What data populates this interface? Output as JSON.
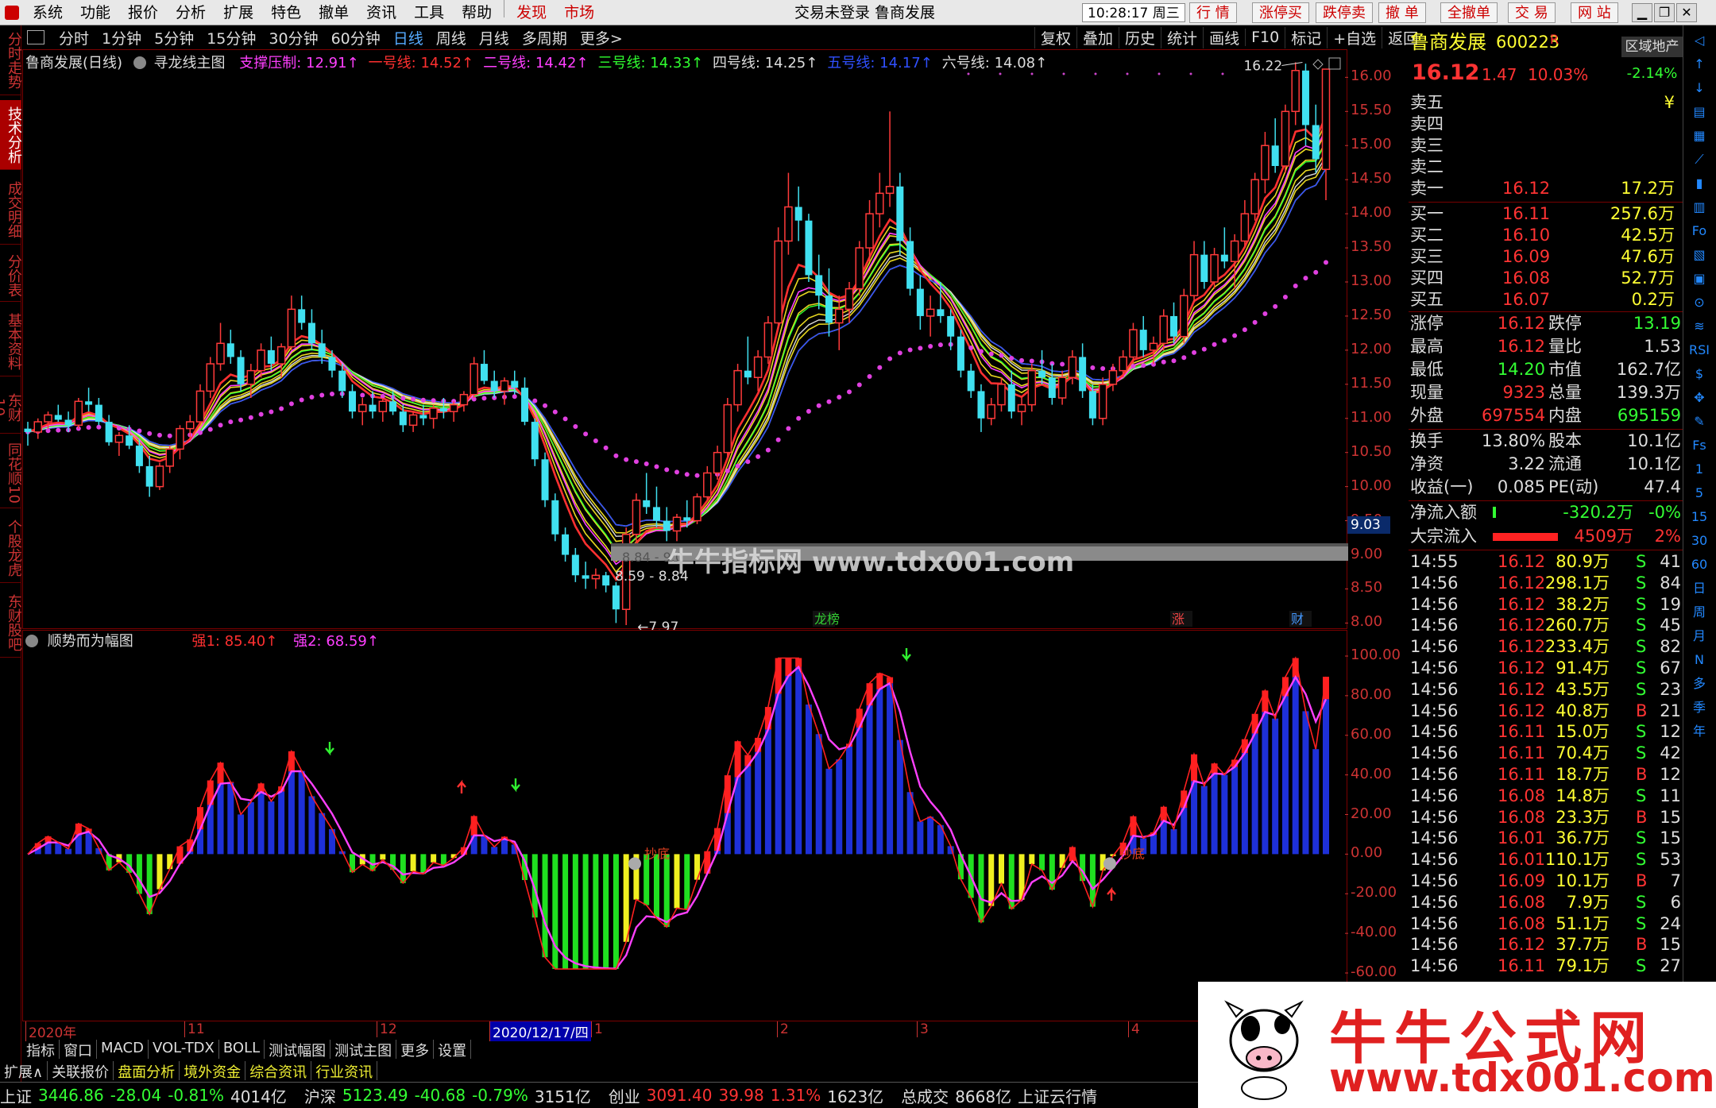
{
  "menu": {
    "items": [
      "系统",
      "功能",
      "报价",
      "分析",
      "扩展",
      "特色",
      "撤单",
      "资讯",
      "工具",
      "帮助"
    ],
    "hl_items": [
      "发现",
      "市场"
    ],
    "title": "交易未登录  鲁商发展",
    "clock": "10:28:17 周三",
    "right_buttons": [
      "行 情",
      "涨停买",
      "跌停卖",
      "撤 单",
      "全撤单",
      "交 易",
      "网 站"
    ]
  },
  "leftbar": [
    "分时走势",
    "技术分析",
    "成交明细",
    "分价表",
    "基本资料",
    "东财10",
    "同花顺10",
    "个股龙虎",
    "东财股吧"
  ],
  "toolbar": {
    "periods": [
      "分时",
      "1分钟",
      "5分钟",
      "15分钟",
      "30分钟",
      "60分钟",
      "日线",
      "周线",
      "月线",
      "多周期",
      "更多>"
    ],
    "active": "日线",
    "right": [
      "复权",
      "叠加",
      "历史",
      "统计",
      "画线",
      "F10",
      "标记",
      "+自选",
      "返回"
    ]
  },
  "main_legend": {
    "stock": "鲁商发展(日线)",
    "indicator": "寻龙线主图",
    "lines": [
      {
        "label": "支撑压制: 12.91",
        "color": "#ff3fff"
      },
      {
        "label": "一号线: 14.52",
        "color": "#ff3030"
      },
      {
        "label": "二号线: 14.42",
        "color": "#ff3fff"
      },
      {
        "label": "三号线: 14.33",
        "color": "#30ff30"
      },
      {
        "label": "四号线: 14.25",
        "color": "#dddddd"
      },
      {
        "label": "五号线: 14.17",
        "color": "#3050ff"
      },
      {
        "label": "六号线: 14.08",
        "color": "#dddddd"
      }
    ]
  },
  "main_axis": [
    "16.00",
    "15.50",
    "15.00",
    "14.50",
    "14.00",
    "13.50",
    "13.00",
    "12.50",
    "12.00",
    "11.50",
    "11.00",
    "10.50",
    "10.00",
    "9.50",
    "9.00",
    "8.50",
    "8.00"
  ],
  "main_annotations": {
    "high": "16.22",
    "low": "7.97",
    "range1": "8.84 - 9.0",
    "range2": "8.59 - 8.84",
    "cursor_price": "9.03",
    "badges": [
      "龙榜",
      "涨",
      "财"
    ]
  },
  "sub_legend": {
    "indicator": "顺势而为幅图",
    "q1": "强1: 85.40",
    "q2": "强2: 68.59"
  },
  "sub_axis": [
    "100.00",
    "80.00",
    "60.00",
    "40.00",
    "20.00",
    "0.00",
    "-20.00",
    "-40.00",
    "-60.00"
  ],
  "sub_annotations": [
    "抄底",
    "抄底"
  ],
  "datebar": [
    "2020年",
    "11",
    "12",
    "2020/12/17/四",
    "1",
    "2",
    "3",
    "4"
  ],
  "ind_tabs": [
    "指标",
    "窗口",
    "MACD",
    "VOL-TDX",
    "BOLL",
    "测试幅图",
    "测试主图",
    "更多",
    "设置"
  ],
  "bottom_tabs": [
    "扩展∧",
    "关联报价",
    "盘面分析",
    "境外资金",
    "综合资讯",
    "行业资讯"
  ],
  "status": [
    {
      "t": "上证",
      "c": "#ddd"
    },
    {
      "t": "3446.86",
      "c": "#3f3"
    },
    {
      "t": "-28.04",
      "c": "#3f3"
    },
    {
      "t": "-0.81%",
      "c": "#3f3"
    },
    {
      "t": "4014亿",
      "c": "#ddd"
    },
    {
      "t": "沪深",
      "c": "#ddd"
    },
    {
      "t": "5123.49",
      "c": "#3f3"
    },
    {
      "t": "-40.68",
      "c": "#3f3"
    },
    {
      "t": "-0.79%",
      "c": "#3f3"
    },
    {
      "t": "3151亿",
      "c": "#ddd"
    },
    {
      "t": "创业",
      "c": "#ddd"
    },
    {
      "t": "3091.40",
      "c": "#f33"
    },
    {
      "t": "39.98",
      "c": "#f33"
    },
    {
      "t": "1.31%",
      "c": "#f33"
    },
    {
      "t": "1623亿",
      "c": "#ddd"
    },
    {
      "t": "总成交",
      "c": "#ddd"
    },
    {
      "t": "8668亿",
      "c": "#ddd"
    },
    {
      "t": "上证云行情",
      "c": "#ddd"
    }
  ],
  "quote": {
    "name": "鲁商发展",
    "code": "600223",
    "tag": "R",
    "sector": "区域地产",
    "sector_pct": "-2.14%",
    "price": "16.12",
    "change": "1.47",
    "pct": "10.03%",
    "asks": [
      {
        "l": "卖五",
        "p": "",
        "v": "¥"
      },
      {
        "l": "卖四",
        "p": "",
        "v": ""
      },
      {
        "l": "卖三",
        "p": "",
        "v": ""
      },
      {
        "l": "卖二",
        "p": "",
        "v": ""
      },
      {
        "l": "卖一",
        "p": "16.12",
        "v": "17.2万"
      }
    ],
    "bids": [
      {
        "l": "买一",
        "p": "16.11",
        "v": "257.6万"
      },
      {
        "l": "买二",
        "p": "16.10",
        "v": "42.5万"
      },
      {
        "l": "买三",
        "p": "16.09",
        "v": "47.6万"
      },
      {
        "l": "买四",
        "p": "16.08",
        "v": "52.7万"
      },
      {
        "l": "买五",
        "p": "16.07",
        "v": "0.2万"
      }
    ],
    "stats": [
      [
        "涨停",
        "16.12",
        "跌停",
        "13.19"
      ],
      [
        "最高",
        "16.12",
        "量比",
        "1.53"
      ],
      [
        "最低",
        "14.20",
        "市值",
        "162.7亿"
      ],
      [
        "现量",
        "9323",
        "总量",
        "139.3万"
      ],
      [
        "外盘",
        "697554",
        "内盘",
        "695159"
      ]
    ],
    "stats2": [
      [
        "换手",
        "13.80%",
        "股本",
        "10.1亿"
      ],
      [
        "净资",
        "3.22",
        "流通",
        "10.1亿"
      ],
      [
        "收益(一)",
        "0.085",
        "PE(动)",
        "47.4"
      ]
    ],
    "flow": [
      {
        "l": "净流入额",
        "v": "-320.2万",
        "p": "-0%"
      },
      {
        "l": "大宗流入",
        "v": "4509万",
        "p": "2%"
      }
    ],
    "ticks": [
      [
        "14:55",
        "16.12",
        "80.9万",
        "S",
        "41"
      ],
      [
        "14:56",
        "16.12",
        "298.1万",
        "S",
        "84"
      ],
      [
        "14:56",
        "16.12",
        "38.2万",
        "S",
        "19"
      ],
      [
        "14:56",
        "16.12",
        "260.7万",
        "S",
        "45"
      ],
      [
        "14:56",
        "16.12",
        "233.4万",
        "S",
        "82"
      ],
      [
        "14:56",
        "16.12",
        "91.4万",
        "S",
        "67"
      ],
      [
        "14:56",
        "16.12",
        "43.5万",
        "S",
        "23"
      ],
      [
        "14:56",
        "16.12",
        "40.8万",
        "B",
        "21"
      ],
      [
        "14:56",
        "16.11",
        "15.0万",
        "S",
        "12"
      ],
      [
        "14:56",
        "16.11",
        "70.4万",
        "S",
        "42"
      ],
      [
        "14:56",
        "16.11",
        "18.7万",
        "B",
        "12"
      ],
      [
        "14:56",
        "16.08",
        "14.8万",
        "S",
        "11"
      ],
      [
        "14:56",
        "16.08",
        "23.3万",
        "B",
        "15"
      ],
      [
        "14:56",
        "16.01",
        "36.7万",
        "S",
        "15"
      ],
      [
        "14:56",
        "16.01",
        "110.1万",
        "S",
        "53"
      ],
      [
        "14:56",
        "16.09",
        "10.1万",
        "B",
        "7"
      ],
      [
        "14:56",
        "16.08",
        "7.9万",
        "S",
        "6"
      ],
      [
        "14:56",
        "16.08",
        "51.1万",
        "S",
        "24"
      ],
      [
        "14:56",
        "16.12",
        "37.7万",
        "B",
        "15"
      ],
      [
        "14:56",
        "16.11",
        "79.1万",
        "S",
        "27"
      ]
    ]
  },
  "iconbar": [
    "◁",
    "↑",
    "↓",
    "▤",
    "▦",
    "⟋",
    "▮",
    "▥",
    "Fo",
    "▧",
    "▣",
    "⊙",
    "≋",
    "RSI",
    "$",
    "✥",
    "✎",
    "Fs",
    "1",
    "5",
    "15",
    "30",
    "60",
    "日",
    "周",
    "月",
    "N",
    "多",
    "季",
    "年"
  ],
  "watermark": {
    "line1": "牛牛公式网",
    "line2": "www.tdx001.com",
    "overlay": "牛牛指标网 www.tdx001.com"
  },
  "chart_data": [
    {
      "type": "candlestick",
      "title": "寻龙线主图",
      "ylim": [
        7.9,
        16.4
      ],
      "ohlc": [
        [
          10.85,
          10.95,
          10.6,
          10.8
        ],
        [
          10.8,
          11.0,
          10.7,
          10.95
        ],
        [
          10.95,
          11.1,
          10.85,
          11.05
        ],
        [
          11.05,
          11.2,
          10.95,
          10.98
        ],
        [
          10.98,
          11.1,
          10.8,
          10.9
        ],
        [
          10.9,
          11.3,
          10.85,
          11.25
        ],
        [
          11.25,
          11.45,
          11.1,
          11.2
        ],
        [
          11.2,
          11.3,
          10.9,
          10.95
        ],
        [
          10.95,
          11.05,
          10.6,
          10.65
        ],
        [
          10.65,
          10.8,
          10.45,
          10.75
        ],
        [
          10.75,
          10.9,
          10.55,
          10.6
        ],
        [
          10.6,
          10.7,
          10.2,
          10.3
        ],
        [
          10.3,
          10.45,
          9.85,
          10.0
        ],
        [
          10.0,
          10.35,
          9.95,
          10.3
        ],
        [
          10.3,
          10.6,
          10.2,
          10.55
        ],
        [
          10.55,
          10.9,
          10.4,
          10.85
        ],
        [
          10.85,
          11.05,
          10.7,
          10.95
        ],
        [
          10.95,
          11.5,
          10.9,
          11.4
        ],
        [
          11.4,
          11.9,
          11.3,
          11.8
        ],
        [
          11.8,
          12.4,
          11.7,
          12.1
        ],
        [
          12.1,
          12.3,
          11.8,
          11.9
        ],
        [
          11.9,
          12.0,
          11.4,
          11.5
        ],
        [
          11.5,
          11.8,
          11.3,
          11.7
        ],
        [
          11.7,
          12.1,
          11.6,
          12.0
        ],
        [
          12.0,
          12.2,
          11.7,
          11.8
        ],
        [
          11.8,
          12.1,
          11.6,
          12.05
        ],
        [
          12.05,
          12.8,
          12.0,
          12.6
        ],
        [
          12.6,
          12.8,
          12.3,
          12.4
        ],
        [
          12.4,
          12.6,
          12.0,
          12.1
        ],
        [
          12.1,
          12.3,
          11.8,
          11.9
        ],
        [
          11.9,
          12.0,
          11.6,
          11.7
        ],
        [
          11.7,
          11.8,
          11.3,
          11.4
        ],
        [
          11.4,
          11.5,
          11.0,
          11.1
        ],
        [
          11.1,
          11.3,
          10.9,
          11.2
        ],
        [
          11.2,
          11.4,
          11.0,
          11.1
        ],
        [
          11.1,
          11.3,
          10.95,
          11.25
        ],
        [
          11.25,
          11.4,
          11.05,
          11.1
        ],
        [
          11.1,
          11.2,
          10.8,
          10.9
        ],
        [
          10.9,
          11.1,
          10.8,
          11.05
        ],
        [
          11.05,
          11.2,
          10.9,
          11.0
        ],
        [
          11.0,
          11.2,
          10.85,
          11.15
        ],
        [
          11.15,
          11.3,
          11.0,
          11.1
        ],
        [
          11.1,
          11.25,
          10.95,
          11.2
        ],
        [
          11.2,
          11.4,
          11.1,
          11.35
        ],
        [
          11.35,
          11.9,
          11.3,
          11.8
        ],
        [
          11.8,
          12.0,
          11.5,
          11.55
        ],
        [
          11.55,
          11.7,
          11.3,
          11.4
        ],
        [
          11.4,
          11.6,
          11.2,
          11.55
        ],
        [
          11.55,
          11.7,
          11.35,
          11.45
        ],
        [
          11.45,
          11.6,
          10.9,
          10.95
        ],
        [
          10.95,
          11.0,
          10.3,
          10.4
        ],
        [
          10.4,
          10.5,
          9.7,
          9.8
        ],
        [
          9.8,
          9.9,
          9.2,
          9.3
        ],
        [
          9.3,
          9.4,
          8.9,
          9.0
        ],
        [
          9.0,
          9.1,
          8.6,
          8.7
        ],
        [
          8.7,
          8.9,
          8.5,
          8.65
        ],
        [
          8.65,
          8.8,
          8.5,
          8.7
        ],
        [
          8.7,
          8.75,
          8.45,
          8.55
        ],
        [
          8.55,
          8.6,
          8.0,
          8.2
        ],
        [
          8.2,
          9.4,
          7.97,
          9.3
        ],
        [
          9.3,
          9.9,
          9.2,
          9.8
        ],
        [
          9.8,
          10.2,
          9.6,
          9.7
        ],
        [
          9.7,
          10.0,
          9.4,
          9.5
        ],
        [
          9.5,
          9.7,
          9.2,
          9.35
        ],
        [
          9.35,
          9.6,
          9.2,
          9.55
        ],
        [
          9.55,
          9.8,
          9.4,
          9.5
        ],
        [
          9.5,
          9.9,
          9.45,
          9.85
        ],
        [
          9.85,
          10.3,
          9.8,
          10.2
        ],
        [
          10.2,
          10.6,
          10.1,
          10.5
        ],
        [
          10.5,
          11.3,
          10.4,
          11.2
        ],
        [
          11.2,
          11.8,
          11.1,
          11.7
        ],
        [
          11.7,
          12.2,
          11.5,
          11.6
        ],
        [
          11.6,
          12.0,
          11.4,
          11.9
        ],
        [
          11.9,
          12.5,
          11.8,
          12.4
        ],
        [
          12.4,
          13.8,
          12.3,
          13.6
        ],
        [
          13.6,
          14.6,
          13.4,
          14.1
        ],
        [
          14.1,
          14.4,
          13.6,
          13.9
        ],
        [
          13.9,
          14.0,
          13.0,
          13.1
        ],
        [
          13.1,
          13.4,
          12.6,
          12.8
        ],
        [
          12.8,
          13.2,
          12.2,
          12.4
        ],
        [
          12.4,
          12.8,
          12.0,
          12.6
        ],
        [
          12.6,
          13.0,
          12.4,
          12.9
        ],
        [
          12.9,
          13.6,
          12.8,
          13.5
        ],
        [
          13.5,
          14.2,
          13.3,
          14.0
        ],
        [
          14.0,
          14.6,
          13.8,
          14.3
        ],
        [
          14.3,
          15.5,
          14.1,
          14.4
        ],
        [
          14.4,
          14.6,
          13.4,
          13.6
        ],
        [
          13.6,
          13.8,
          12.8,
          12.9
        ],
        [
          12.9,
          13.1,
          12.3,
          12.5
        ],
        [
          12.5,
          12.8,
          12.2,
          12.6
        ],
        [
          12.6,
          13.0,
          12.4,
          12.5
        ],
        [
          12.5,
          12.6,
          12.0,
          12.2
        ],
        [
          12.2,
          12.3,
          11.6,
          11.7
        ],
        [
          11.7,
          11.8,
          11.3,
          11.4
        ],
        [
          11.4,
          11.5,
          10.8,
          11.0
        ],
        [
          11.0,
          11.3,
          10.9,
          11.2
        ],
        [
          11.2,
          11.6,
          11.1,
          11.5
        ],
        [
          11.5,
          11.7,
          11.0,
          11.1
        ],
        [
          11.1,
          11.3,
          10.9,
          11.2
        ],
        [
          11.2,
          11.8,
          11.1,
          11.7
        ],
        [
          11.7,
          12.0,
          11.5,
          11.6
        ],
        [
          11.6,
          11.8,
          11.2,
          11.3
        ],
        [
          11.3,
          11.7,
          11.2,
          11.6
        ],
        [
          11.6,
          12.0,
          11.5,
          11.9
        ],
        [
          11.9,
          12.1,
          11.3,
          11.4
        ],
        [
          11.4,
          11.5,
          10.9,
          11.0
        ],
        [
          11.0,
          11.6,
          10.9,
          11.5
        ],
        [
          11.5,
          11.8,
          11.4,
          11.7
        ],
        [
          11.7,
          12.0,
          11.6,
          11.9
        ],
        [
          11.9,
          12.4,
          11.8,
          12.3
        ],
        [
          12.3,
          12.5,
          11.9,
          12.0
        ],
        [
          12.0,
          12.2,
          11.8,
          12.1
        ],
        [
          12.1,
          12.6,
          12.0,
          12.5
        ],
        [
          12.5,
          12.7,
          12.1,
          12.2
        ],
        [
          12.2,
          12.9,
          12.1,
          12.8
        ],
        [
          12.8,
          13.6,
          12.7,
          13.4
        ],
        [
          13.4,
          13.6,
          12.9,
          13.0
        ],
        [
          13.0,
          13.5,
          12.9,
          13.4
        ],
        [
          13.4,
          13.8,
          13.2,
          13.3
        ],
        [
          13.3,
          13.7,
          12.9,
          13.6
        ],
        [
          13.6,
          14.2,
          13.5,
          14.0
        ],
        [
          14.0,
          14.6,
          13.9,
          14.5
        ],
        [
          14.5,
          15.2,
          14.3,
          15.0
        ],
        [
          15.0,
          15.4,
          14.6,
          14.7
        ],
        [
          14.7,
          15.6,
          14.6,
          15.5
        ],
        [
          15.5,
          16.22,
          15.3,
          16.1
        ],
        [
          16.1,
          16.2,
          15.0,
          15.3
        ],
        [
          15.3,
          15.6,
          14.6,
          14.8
        ],
        [
          14.65,
          16.12,
          14.2,
          16.12
        ]
      ]
    },
    {
      "type": "bar",
      "title": "顺势而为幅图",
      "ylim": [
        -60,
        100
      ],
      "series": [
        {
          "name": "强1",
          "value": 85.4
        },
        {
          "name": "强2",
          "value": 68.59
        }
      ]
    }
  ]
}
